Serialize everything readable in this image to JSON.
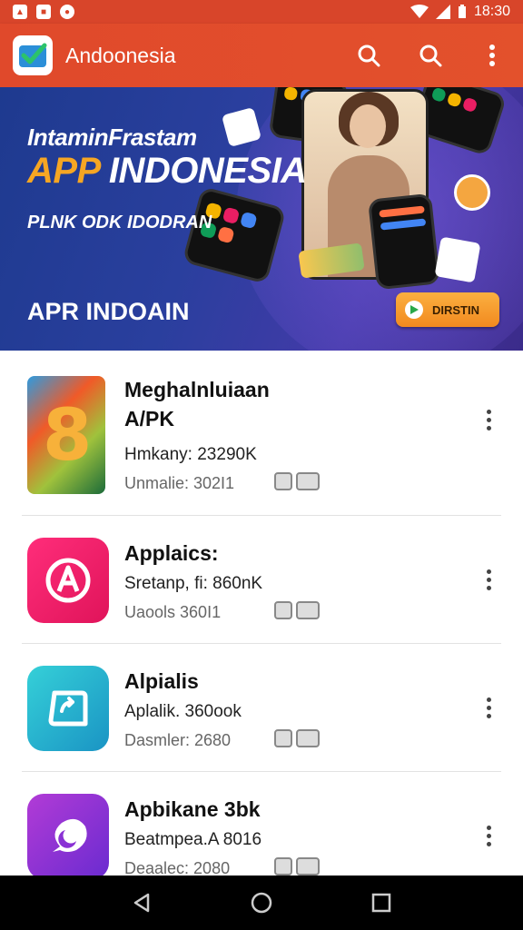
{
  "status_bar": {
    "time": "18:30"
  },
  "app_bar": {
    "title": "Andoonesia",
    "brand_color": "#e0492b"
  },
  "banner": {
    "line1": "IntaminFrastam",
    "line2_accent": "APP",
    "line2_rest": " INDONESIA",
    "line3": "PLNK ODK IDODRAN",
    "line4": "APR INDOAIN",
    "button_label": "DIRSTIN"
  },
  "apps": [
    {
      "name": "Meghalnluiaan",
      "name_line2": "A/PK",
      "sub1": "Hmkany: 23290K",
      "sub2": "Unmalie: 302I1",
      "icon": "colorful-8-icon"
    },
    {
      "name": "Applaics:",
      "sub1": "Sretanp, fi: 860nK",
      "sub2": "Uaools 360I1",
      "icon": "pink-a-icon"
    },
    {
      "name": "Alpialis",
      "sub1": "Aplalik. 360ook",
      "sub2": "Dasmler: 2680",
      "icon": "teal-sync-icon"
    },
    {
      "name": "Apbikane 3bk",
      "sub1": "Beatmpea.A 8016",
      "sub2": "Deaalec: 2080",
      "icon": "purple-moon-icon"
    }
  ]
}
